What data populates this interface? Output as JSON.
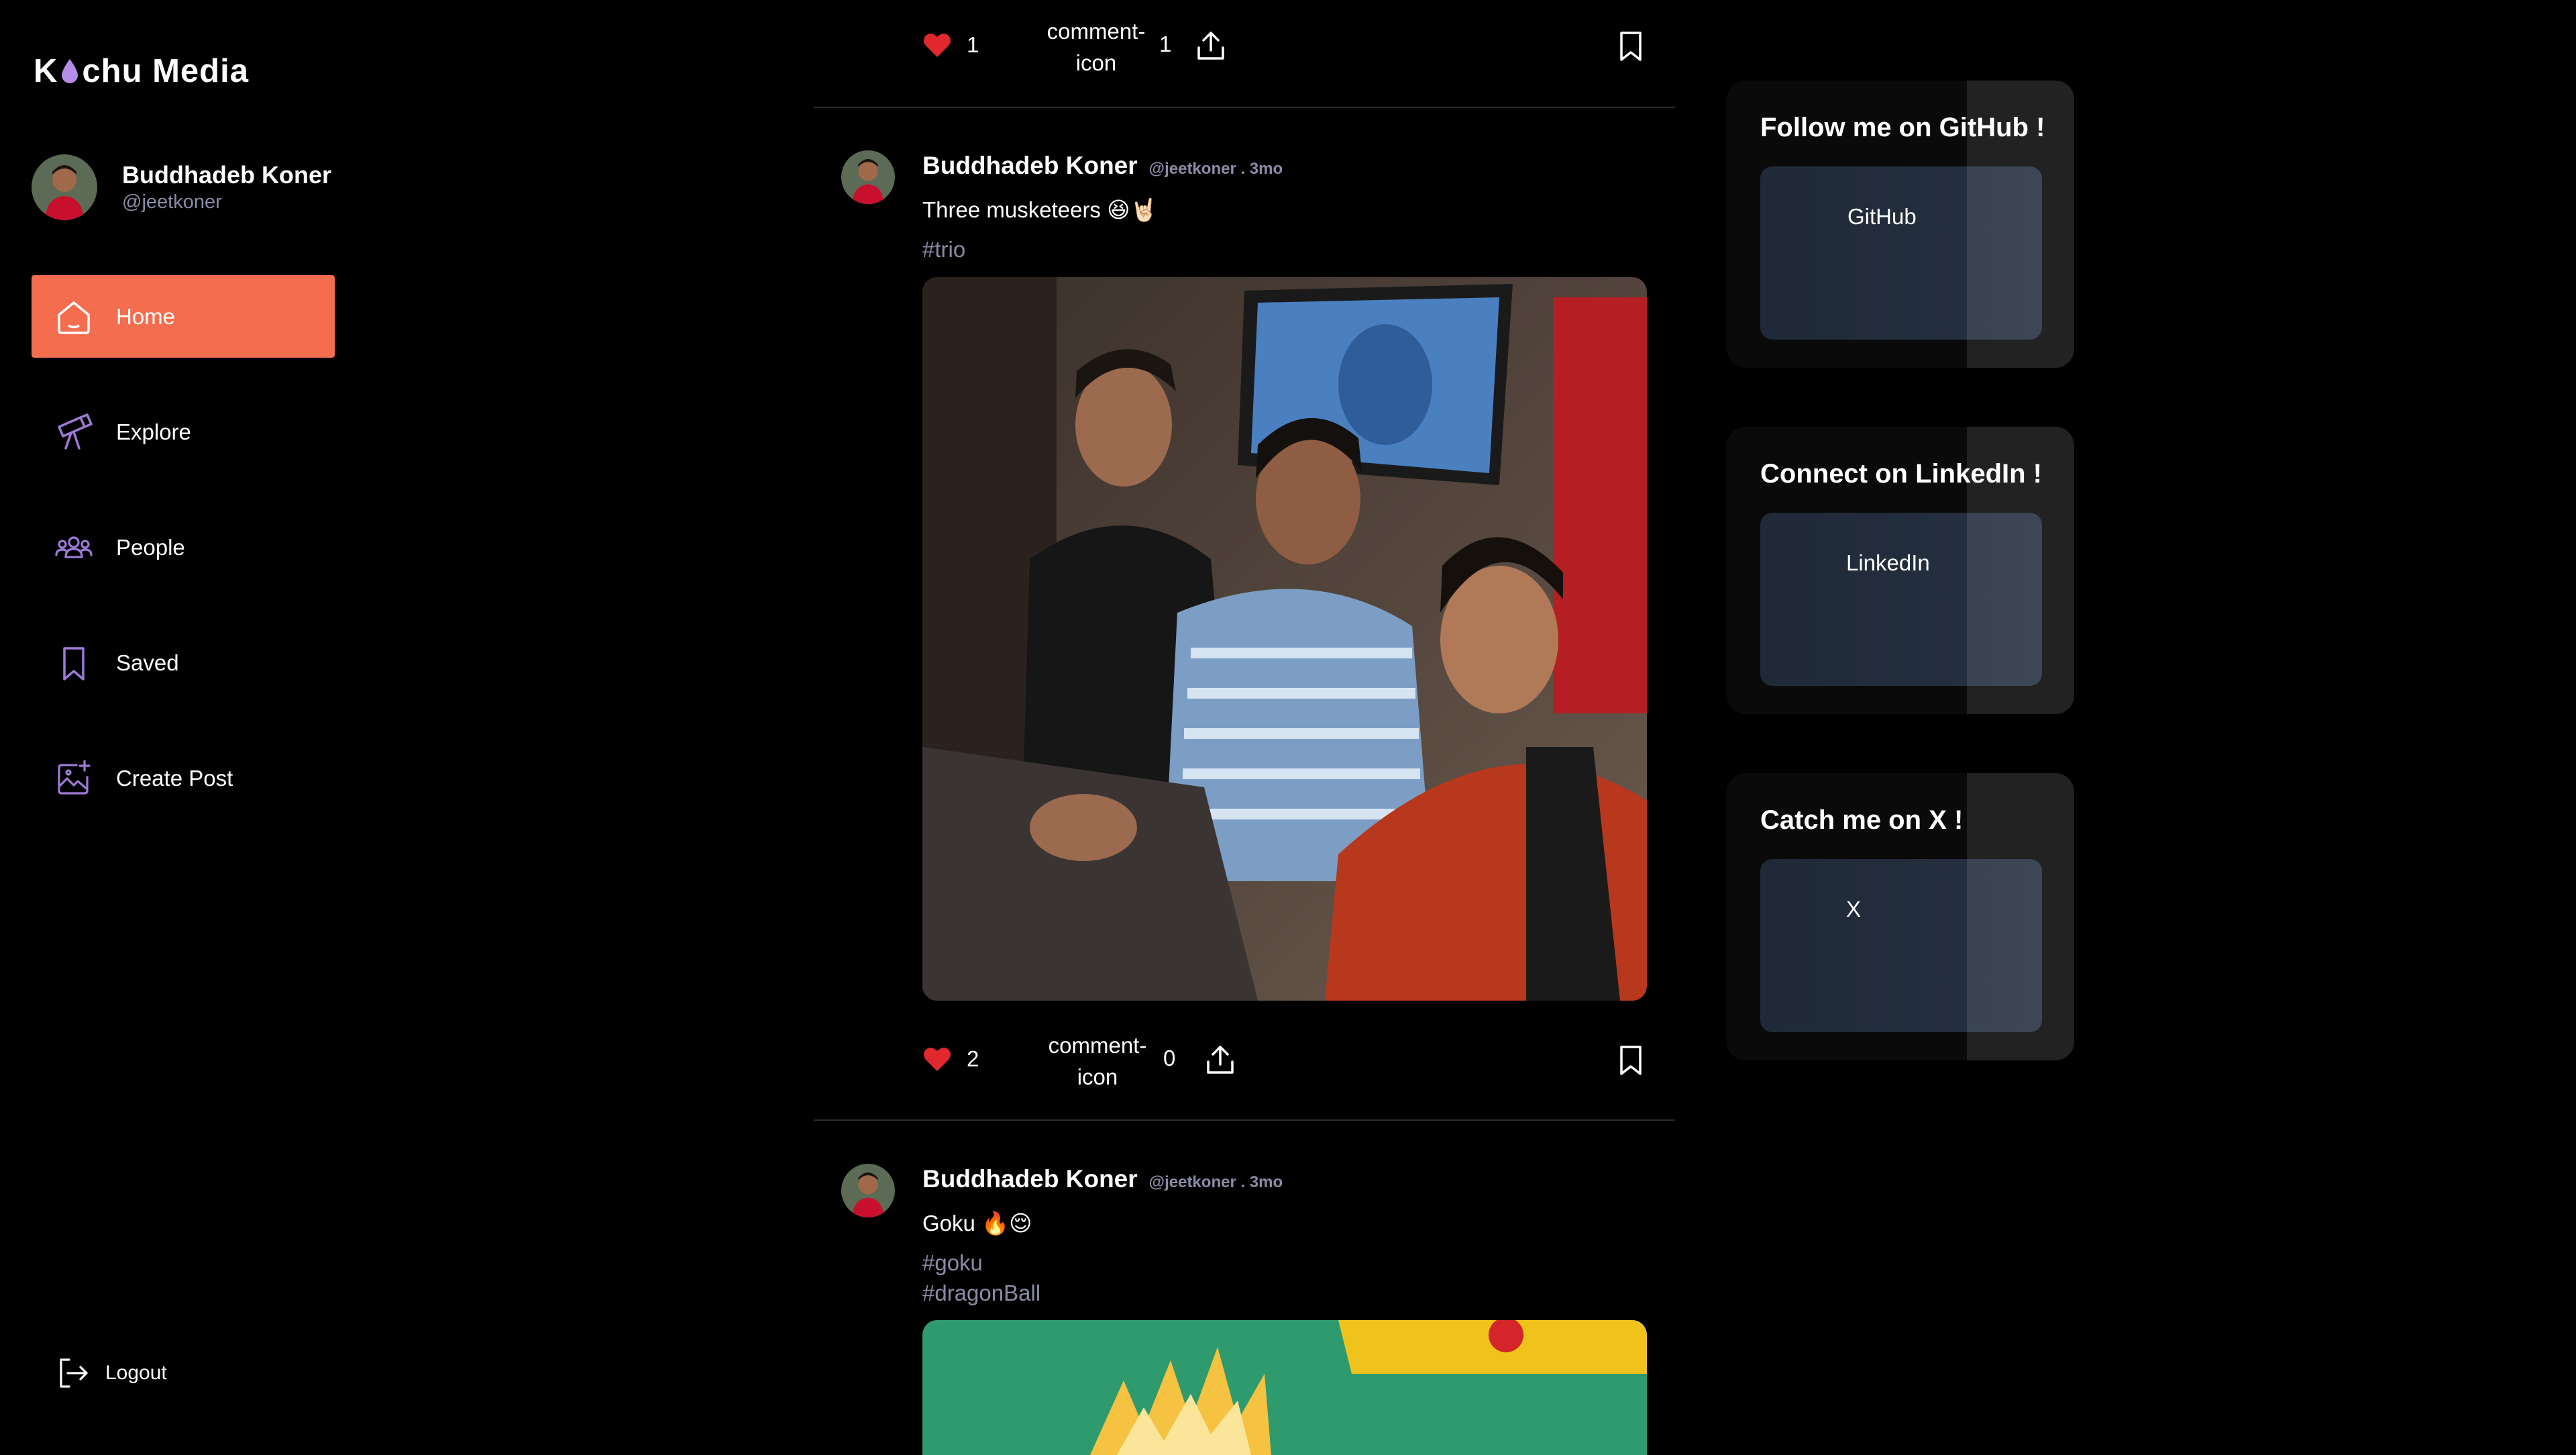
{
  "app": {
    "logo_pre": "K",
    "logo_post": "chu Media"
  },
  "colors": {
    "accent": "#f46d4e",
    "muted": "#8b8ba7",
    "like": "#e0282e",
    "card_button": "#1f2937"
  },
  "user": {
    "name": "Buddhadeb Koner",
    "handle": "@jeetkoner"
  },
  "nav": {
    "items": [
      {
        "label": "Home",
        "icon": "home-icon",
        "active": true
      },
      {
        "label": "Explore",
        "icon": "telescope-icon",
        "active": false
      },
      {
        "label": "People",
        "icon": "people-icon",
        "active": false
      },
      {
        "label": "Saved",
        "icon": "bookmark-icon",
        "active": false
      },
      {
        "label": "Create Post",
        "icon": "image-plus-icon",
        "active": false
      }
    ],
    "logout_label": "Logout"
  },
  "feed": {
    "top_actions": {
      "likes": "1",
      "comment_icon_alt": "comment-icon",
      "comments": "1"
    },
    "posts": [
      {
        "author": "Buddhadeb Koner",
        "meta": "@jeetkoner . 3mo",
        "caption": "Three musketeers 😆🤘🏻",
        "tags": [
          "#trio"
        ],
        "likes": "2",
        "comment_icon_alt": "comment-icon",
        "comments": "0"
      },
      {
        "author": "Buddhadeb Koner",
        "meta": "@jeetkoner . 3mo",
        "caption": "Goku 🔥😌",
        "tags": [
          "#goku",
          "#dragonBall"
        ]
      }
    ]
  },
  "cards": [
    {
      "title": "Follow me on GitHub !",
      "button": "GitHub"
    },
    {
      "title": "Connect on LinkedIn !",
      "button": "LinkedIn"
    },
    {
      "title": "Catch me on X !",
      "button": "X"
    }
  ]
}
